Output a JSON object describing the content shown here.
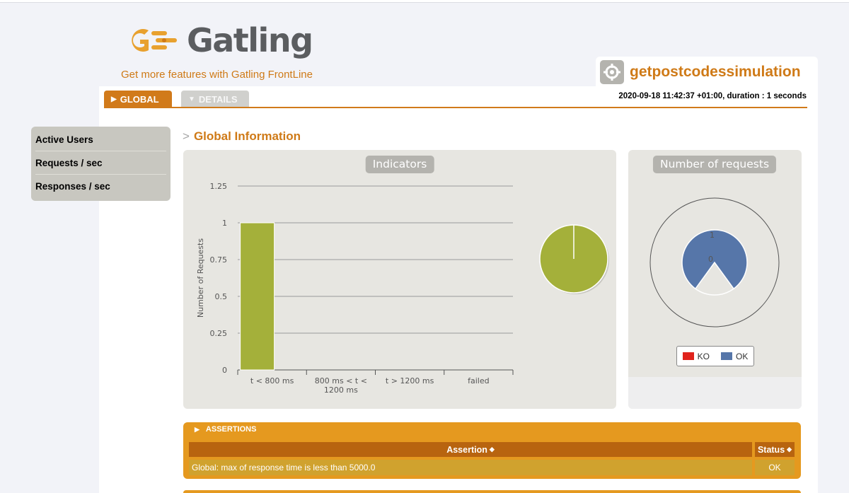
{
  "brand": {
    "name": "Gatling",
    "frontline_link": "Get more features with Gatling FrontLine",
    "accent_color": "#cf7a17"
  },
  "simulation": {
    "name": "getpostcodessimulation",
    "run_info": "2020-09-18 11:42:37 +01:00, duration : 1 seconds"
  },
  "tabs": [
    {
      "label": "GLOBAL",
      "icon": "triangle-right-icon",
      "active": true
    },
    {
      "label": "DETAILS",
      "icon": "triangle-down-icon",
      "active": false
    }
  ],
  "menu": {
    "items": [
      {
        "label": "Active Users"
      },
      {
        "label": "Requests / sec"
      },
      {
        "label": "Responses / sec"
      }
    ]
  },
  "section_title": "Global Information",
  "section_prefix": ">",
  "panels": {
    "indicators_label": "Indicators",
    "requests_label": "Number of requests"
  },
  "chart_data": [
    {
      "type": "bar",
      "title": "Indicators",
      "ylabel": "Number of Requests",
      "categories": [
        "t < 800 ms",
        "800 ms < t < 1200 ms",
        "t > 1200 ms",
        "failed"
      ],
      "values": [
        1,
        0,
        0,
        0
      ],
      "ylim": [
        0,
        1.25
      ],
      "yticks": [
        "0",
        "0.25",
        "0.5",
        "0.75",
        "1",
        "1.25"
      ],
      "bar_color": "#a4b03a",
      "grid": true
    },
    {
      "type": "pie",
      "categories": [
        "t < 800 ms",
        "800 ms < t < 1200 ms",
        "t > 1200 ms",
        "failed"
      ],
      "values": [
        1,
        0,
        0,
        0
      ],
      "color": "#a4b03a"
    },
    {
      "type": "pie",
      "title": "Number of requests",
      "series": [
        {
          "name": "KO",
          "values": [
            0
          ]
        },
        {
          "name": "OK",
          "values": [
            1
          ]
        }
      ],
      "labels": [
        "1",
        "0"
      ],
      "colors": {
        "KO": "#e0231c",
        "OK": "#5676a9"
      },
      "legend": "bottom"
    }
  ],
  "legend": {
    "items": [
      {
        "label": "KO",
        "color": "#e0231c"
      },
      {
        "label": "OK",
        "color": "#5676a9"
      }
    ]
  },
  "assertions": {
    "title": "ASSERTIONS",
    "columns": {
      "assertion": "Assertion",
      "status": "Status"
    },
    "rows": [
      {
        "assertion": "Global: max of response time is less than 5000.0",
        "status": "OK"
      }
    ]
  }
}
